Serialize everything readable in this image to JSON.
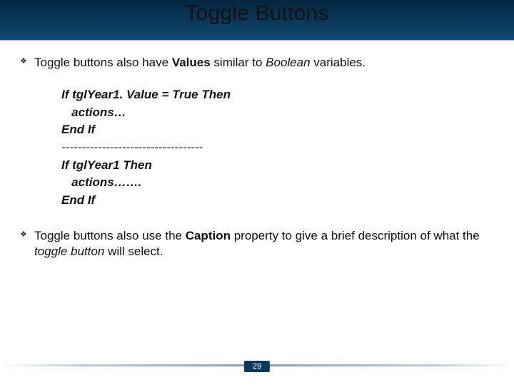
{
  "title": "Toggle Buttons",
  "bullets": {
    "b1": {
      "pre": "Toggle buttons also have ",
      "bold": "Values",
      "mid": " similar to ",
      "ital": "Boolean",
      "post": " variables."
    },
    "b2": {
      "pre": "Toggle buttons also use the ",
      "bold": "Caption",
      "mid": " property to give a brief description of what the ",
      "ital": "toggle button",
      "post": " will select."
    }
  },
  "code": {
    "l1": "If tglYear1. Value = True Then",
    "l2": "   actions…",
    "l3": "End If",
    "sep": "-----------------------------------",
    "l4": "If tglYear1 Then",
    "l5": "   actions……. ",
    "l6": "End If"
  },
  "page": "29"
}
